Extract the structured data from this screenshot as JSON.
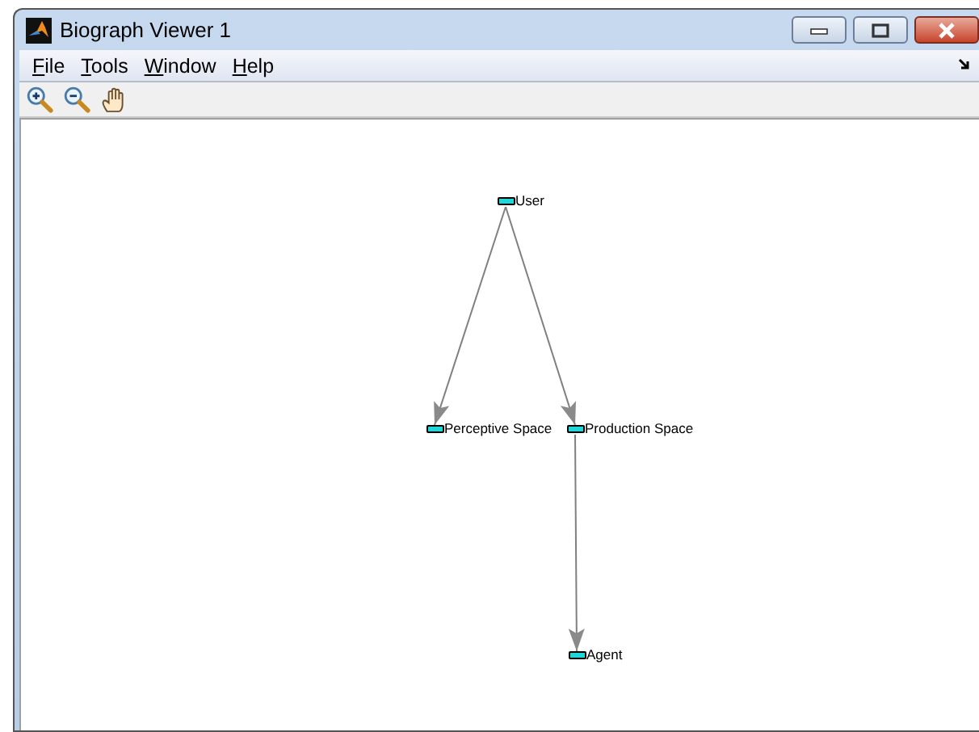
{
  "window": {
    "title": "Biograph Viewer 1"
  },
  "menu": [
    {
      "label": "File"
    },
    {
      "label": "Tools"
    },
    {
      "label": "Window"
    },
    {
      "label": "Help"
    }
  ],
  "toolbar": [
    {
      "kind": "zoom-in"
    },
    {
      "kind": "zoom-out"
    },
    {
      "kind": "pan"
    }
  ],
  "graph": {
    "nodes": [
      {
        "label": "User"
      },
      {
        "label": "Perceptive Space"
      },
      {
        "label": "Production Space"
      },
      {
        "label": "Agent"
      }
    ]
  }
}
